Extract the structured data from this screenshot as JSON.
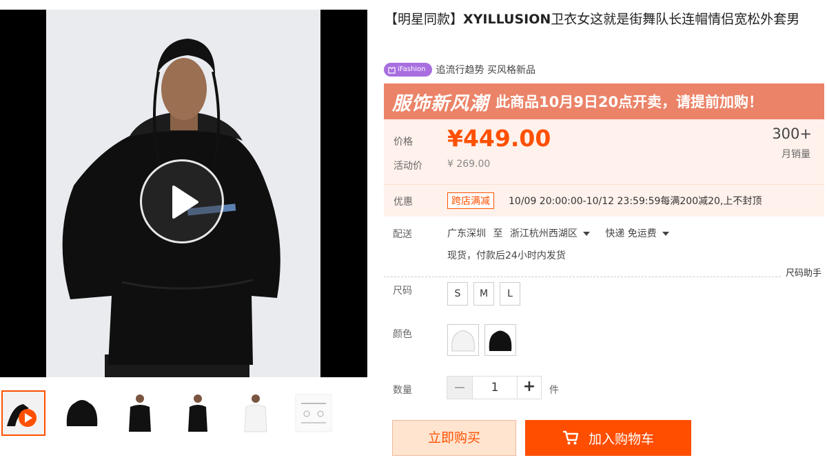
{
  "product": {
    "title_prefix": "【明星同款】",
    "title_brand": "XYILLUSION",
    "title_rest": "卫衣女这就是街舞队长连帽情侣宽松外套男"
  },
  "ifashion": {
    "badge": "iFashion",
    "slogan": "追流行趋势 买风格新品"
  },
  "banner": {
    "big": "服饰新风潮",
    "sub": "此商品10月9日20点开卖，请提前加购！"
  },
  "price": {
    "label": "价格",
    "value": "¥449.00",
    "promo_label": "活动价",
    "promo_value": "¥ 269.00",
    "sales_count": "300+",
    "sales_label": "月销量"
  },
  "coupon": {
    "label": "优惠",
    "badge": "跨店满减",
    "text": "10/09 20:00:00-10/12 23:59:59每满200减20,上不封顶"
  },
  "shipping": {
    "label": "配送",
    "from": "广东深圳",
    "to_word": "至",
    "to": "浙江杭州西湖区",
    "method": "快递 免运费",
    "stock": "现货，付款后24小时内发货"
  },
  "size_helper": "尺码助手",
  "size": {
    "label": "尺码",
    "options": [
      "S",
      "M",
      "L"
    ]
  },
  "color": {
    "label": "颜色",
    "options": [
      "white-hoodie",
      "black-hoodie"
    ]
  },
  "quantity": {
    "label": "数量",
    "value": "1",
    "plus": "+",
    "unit": "件"
  },
  "actions": {
    "buy_now": "立即购买",
    "add_cart": "加入购物车"
  },
  "colors": {
    "accent": "#ff5000",
    "banner": "#eb8368",
    "price_bg": "#fff1eb",
    "ifashion": "#a86ee0"
  }
}
